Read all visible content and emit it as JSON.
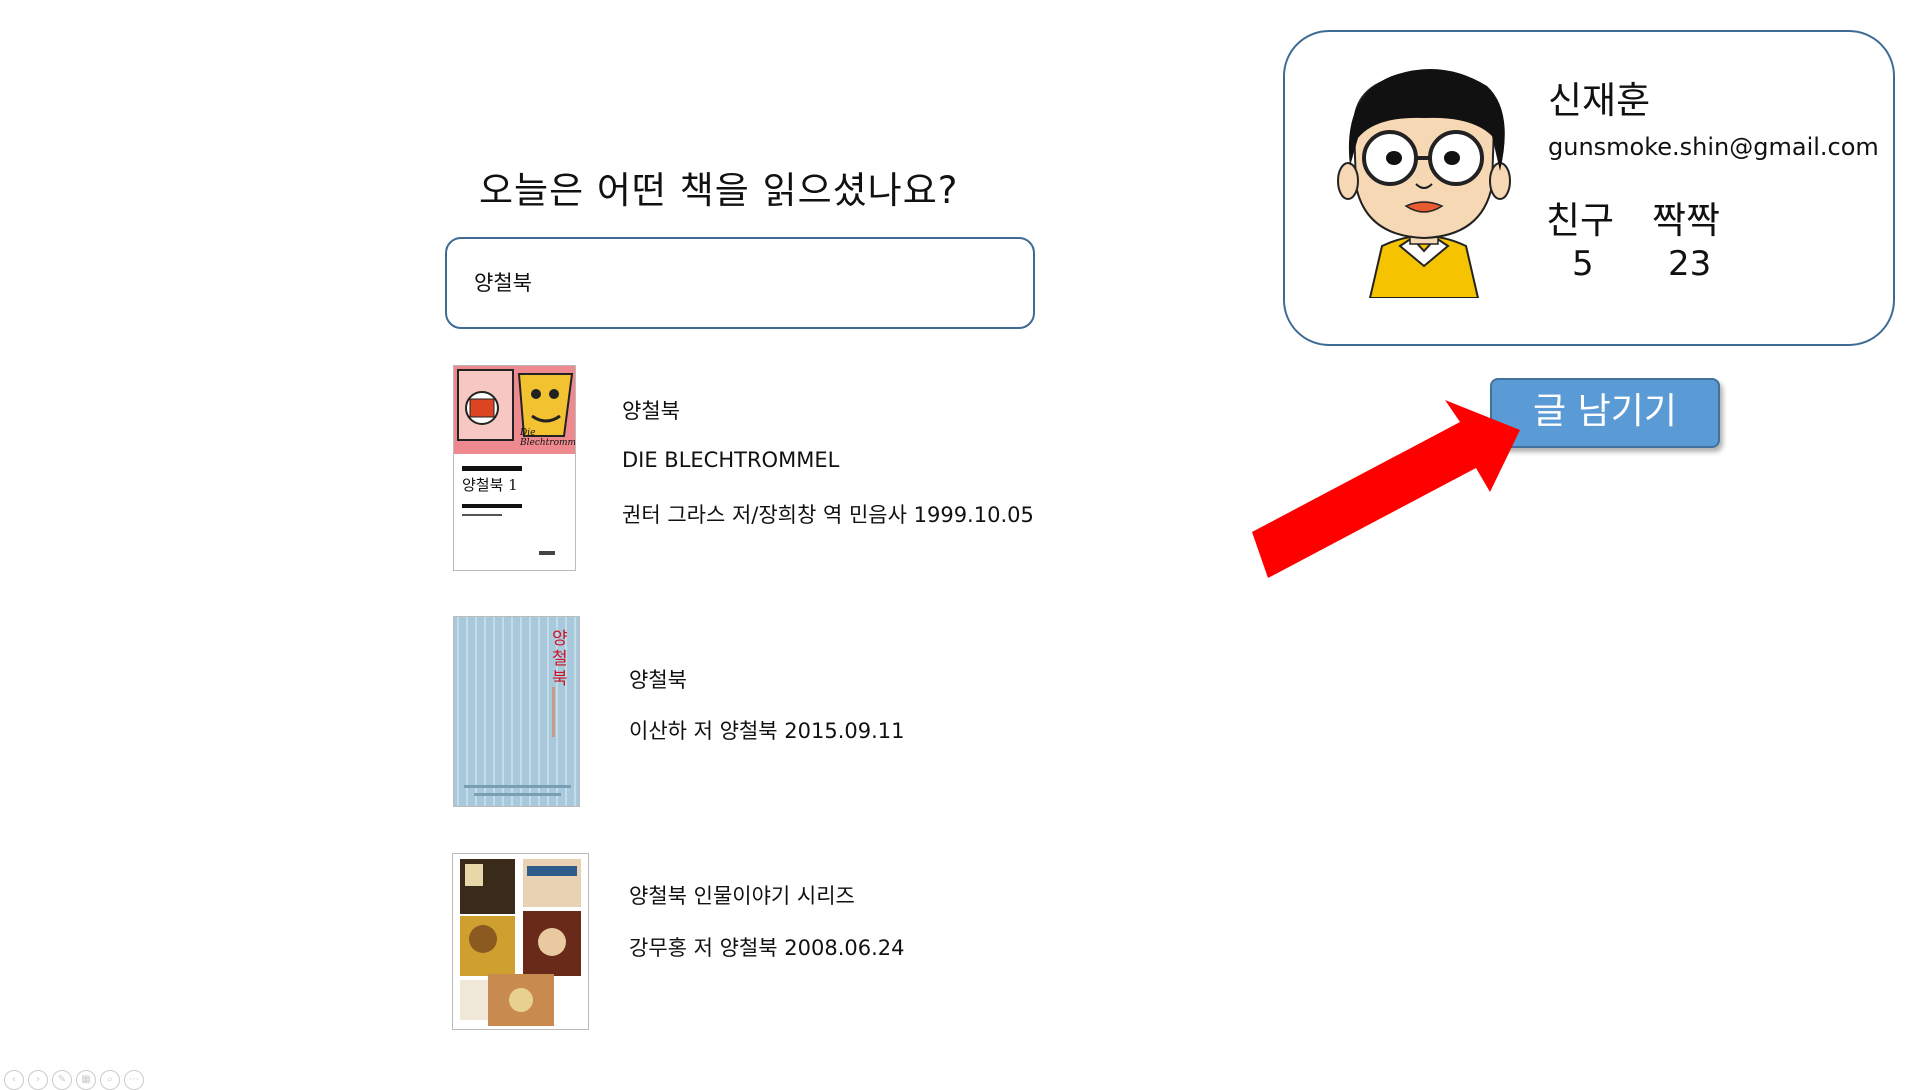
{
  "search": {
    "question": "오늘은 어떤 책을 읽으셨나요?",
    "value": "양철북"
  },
  "results": [
    {
      "title": "양철북",
      "subtitle": "DIE BLECHTROMMEL",
      "meta": "권터 그라스 저/장희창 역  민음사  1999.10.05",
      "cover_label": "양철북 1",
      "cover_top_text": "Die Blechtrommel"
    },
    {
      "title": "양철북",
      "meta": "이산하 저  양철북  2015.09.11",
      "cover_label": "양철북"
    },
    {
      "title": "양철북 인물이야기 시리즈",
      "meta": "강무홍 저  양철북  2008.06.24"
    }
  ],
  "profile": {
    "name": "신재훈",
    "email": "gunsmoke.shin@gmail.com",
    "friends_label": "친구",
    "friends_count": "5",
    "partner_label": "짝짝",
    "partner_count": "23"
  },
  "write_button": {
    "label": "글 남기기"
  },
  "colors": {
    "border": "#3e6b95",
    "button_bg": "#5b9bd5",
    "arrow": "#ff0000"
  }
}
